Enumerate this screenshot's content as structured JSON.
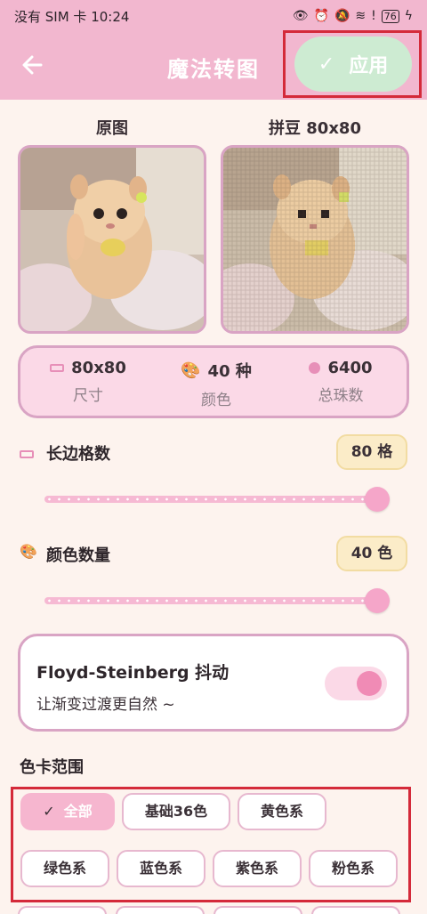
{
  "status_bar": {
    "left": "没有 SIM 卡 10:24",
    "battery": "76"
  },
  "header": {
    "back_icon": "arrow-left-icon",
    "title": "魔法转图",
    "apply_label": "应用",
    "apply_check": "✓"
  },
  "preview": {
    "original_label": "原图",
    "pixel_label": "拼豆 80x80"
  },
  "stats": [
    {
      "icon": "ruler-icon",
      "value": "80x80",
      "label": "尺寸"
    },
    {
      "icon": "palette-icon",
      "value": "40 种",
      "label": "颜色"
    },
    {
      "icon": "bead-icon",
      "value": "6400",
      "label": "总珠数"
    }
  ],
  "long_side": {
    "title": "长边格数",
    "badge": "80 格",
    "level": 1.0
  },
  "color_count": {
    "title": "颜色数量",
    "badge": "40 色",
    "level": 1.0
  },
  "dither": {
    "title": "Floyd-Steinberg 抖动",
    "subtitle": "让渐变过渡更自然 ~",
    "enabled": true
  },
  "palette": {
    "title": "色卡范围",
    "chips": [
      {
        "label": "全部",
        "active": true
      },
      {
        "label": "基础36色",
        "active": false
      },
      {
        "label": "黄色系",
        "active": false
      },
      {
        "label": "绿色系",
        "active": false
      },
      {
        "label": "蓝色系",
        "active": false
      },
      {
        "label": "紫色系",
        "active": false
      },
      {
        "label": "粉色系",
        "active": false
      }
    ]
  },
  "colors": {
    "accent": "#f2b7cf",
    "highlight": "#d42a3a",
    "apply_bg": "#cdebd2"
  }
}
